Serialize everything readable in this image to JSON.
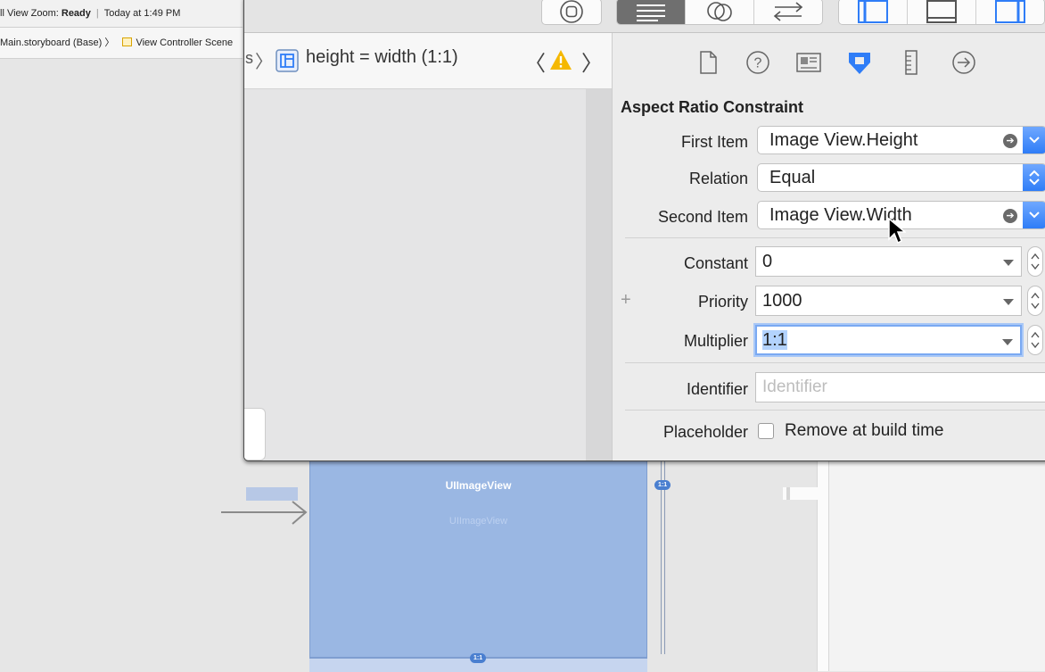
{
  "background_window": {
    "status_prefix": "ll View Zoom: ",
    "status_bold": "Ready",
    "status_divider": "|",
    "status_time": "Today at 1:49 PM",
    "breadcrumb_file": "Main.storyboard (Base)",
    "breadcrumb_sep": "〉",
    "breadcrumb_scene": "View Controller Scene"
  },
  "canvas": {
    "image_view_title": "UIImageView",
    "image_view_subtitle": "UIImageView",
    "badge_side": "1:1",
    "badge_bottom": "1:1"
  },
  "jump_bar": {
    "left_fragment": "s",
    "sep": "〉",
    "constraint_label": "height = width (1:1)",
    "prev": "〈",
    "next": "〉"
  },
  "inspector": {
    "tabs": [
      "file-inspector",
      "quick-help",
      "identity-inspector",
      "attributes-inspector",
      "size-inspector",
      "connections-inspector"
    ],
    "active_tab": "attributes-inspector",
    "section_title": "Aspect Ratio Constraint",
    "first_item_label": "First Item",
    "first_item_value": "Image View.Height",
    "relation_label": "Relation",
    "relation_value": "Equal",
    "second_item_label": "Second Item",
    "second_item_value": "Image View.Width",
    "constant_label": "Constant",
    "constant_value": "0",
    "priority_label": "Priority",
    "priority_value": "1000",
    "multiplier_label": "Multiplier",
    "multiplier_value": "1:1",
    "identifier_label": "Identifier",
    "identifier_placeholder": "Identifier",
    "placeholder_label": "Placeholder",
    "placeholder_checkbox_label": "Remove at build time",
    "placeholder_checked": false
  },
  "colors": {
    "accent_blue": "#2f7df7",
    "warning_yellow": "#f5b800",
    "image_view_fill": "#9ab7e3"
  }
}
